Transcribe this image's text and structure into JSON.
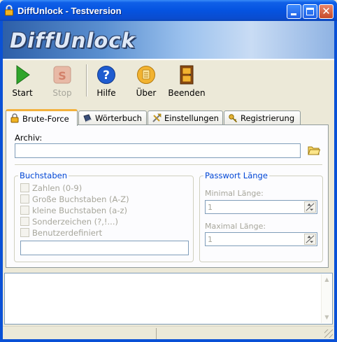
{
  "window": {
    "title": "DiffUnlock - Testversion",
    "close_glyph": "✕",
    "icon": "padlock-icon"
  },
  "banner": {
    "logo_text": "DiffUnlock"
  },
  "toolbar": {
    "start": "Start",
    "stop": "Stop",
    "hilfe": "Hilfe",
    "ueber": "Über",
    "beenden": "Beenden"
  },
  "tabs": {
    "brute_force": "Brute-Force",
    "woerterbuch": "Wörterbuch",
    "einstellungen": "Einstellungen",
    "registrierung": "Registrierung"
  },
  "brute_force": {
    "archiv_label": "Archiv:",
    "archiv_value": "",
    "buchstaben": {
      "title": "Buchstaben",
      "options": [
        "Zahlen (0-9)",
        "Große Buchstaben (A-Z)",
        "kleine Buchstaben (a-z)",
        "Sonderzeichen (?,!...)",
        "Benutzerdefiniert"
      ],
      "custom_value": ""
    },
    "passwort_laenge": {
      "title": "Passwort Länge",
      "minimal_label": "Minimal Länge:",
      "minimal_value": "1",
      "maximal_label": "Maximal Länge:",
      "maximal_value": "1"
    }
  },
  "colors": {
    "titlebar": "#0553e0",
    "group_title": "#0046d5",
    "active_tab_accent": "#f3b13c",
    "disabled_text": "#a7a69b"
  }
}
